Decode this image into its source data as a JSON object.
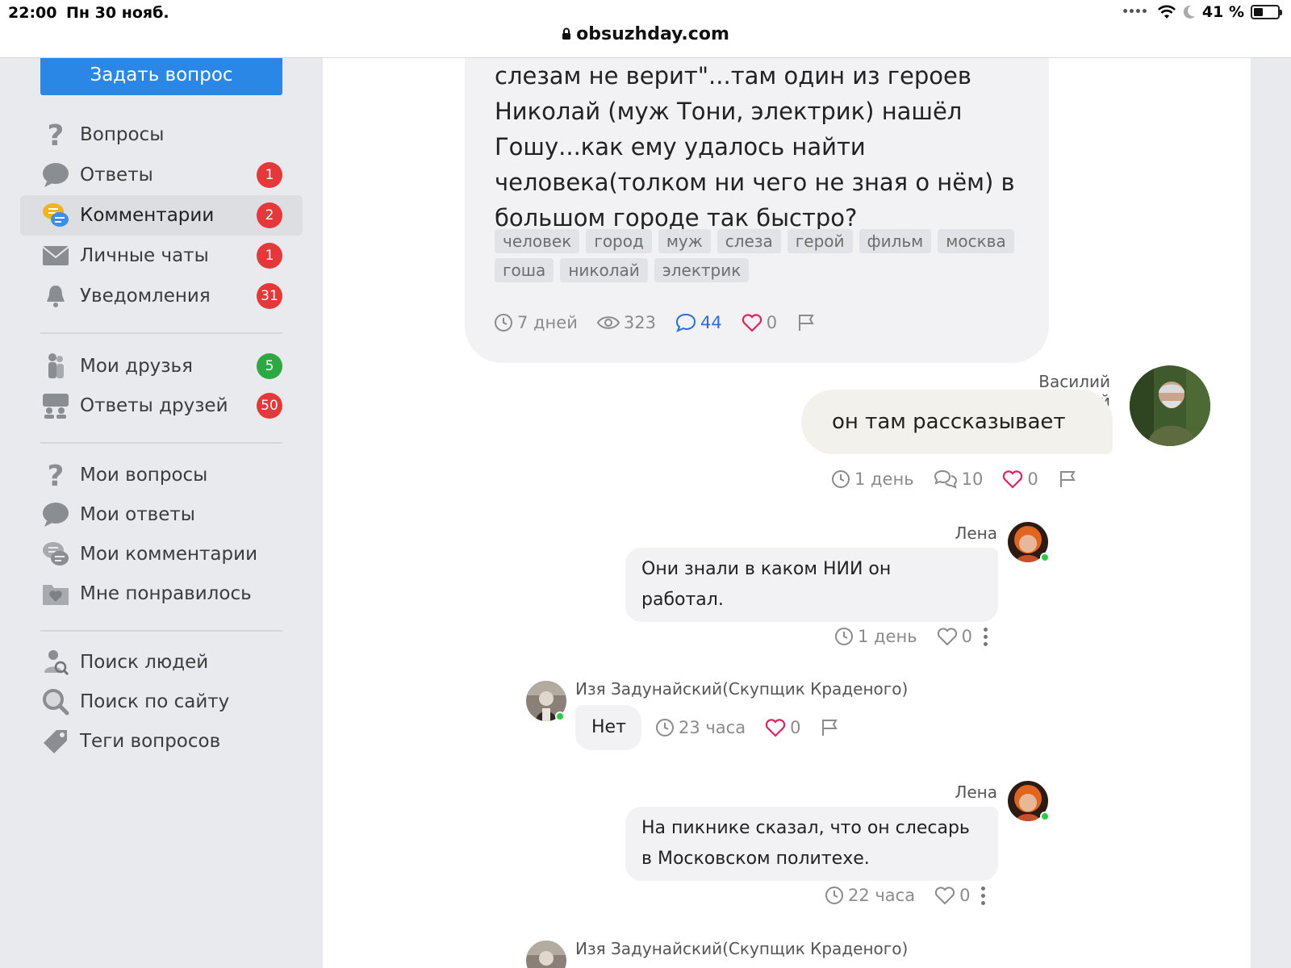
{
  "status_bar": {
    "time": "22:00",
    "date": "Пн 30 нояб.",
    "battery": "41 %",
    "battery_level": 0.41
  },
  "browser": {
    "url": "obsuzhday.com"
  },
  "sidebar": {
    "ask_button": "Задать вопрос",
    "items": [
      {
        "label": "Вопросы",
        "icon": "question-icon",
        "badge": ""
      },
      {
        "label": "Ответы",
        "icon": "chat-bubble-icon",
        "badge": "1"
      },
      {
        "label": "Комментарии",
        "icon": "comments-icon",
        "badge": "2",
        "active": true
      },
      {
        "label": "Личные чаты",
        "icon": "envelope-icon",
        "badge": "1"
      },
      {
        "label": "Уведомления",
        "icon": "bell-icon",
        "badge": "31"
      },
      {
        "label": "Мои друзья",
        "icon": "friends-icon",
        "badge": "5",
        "badge_color": "#2ea843"
      },
      {
        "label": "Ответы друзей",
        "icon": "friends-answers-icon",
        "badge": "50"
      },
      {
        "label": "Мои вопросы",
        "icon": "question-icon",
        "badge": ""
      },
      {
        "label": "Мои ответы",
        "icon": "chat-bubble-icon",
        "badge": ""
      },
      {
        "label": "Мои комментарии",
        "icon": "comments-icon",
        "badge": ""
      },
      {
        "label": "Мне понравилось",
        "icon": "heart-folder-icon",
        "badge": ""
      },
      {
        "label": "Поиск людей",
        "icon": "person-search-icon",
        "badge": ""
      },
      {
        "label": "Поиск по сайту",
        "icon": "magnifier-icon",
        "badge": ""
      },
      {
        "label": "Теги вопросов",
        "icon": "tag-icon",
        "badge": ""
      }
    ]
  },
  "question": {
    "text": "слезам не верит\"...там один из героев Николай (муж Тони, электрик) нашёл Гошу...как ему удалось найти человека(толком ни чего не зная о нём) в большом городе так быстро?",
    "tags": [
      "человек",
      "город",
      "муж",
      "слеза",
      "герой",
      "фильм",
      "москва",
      "гоша",
      "николай",
      "электрик"
    ],
    "time": "7 дней",
    "views": "323",
    "answers": "44",
    "likes": "0"
  },
  "answer": {
    "author": "Василий Галемский",
    "text": "он там рассказывает",
    "time": "1 день",
    "comments": "10",
    "likes": "0"
  },
  "comments": [
    {
      "author": "Лена",
      "text_line1": "Они знали в каком НИИ он",
      "text_line2": "работал.",
      "time": "1 день",
      "likes": "0"
    },
    {
      "author": "Изя Задунайский(Скупщик Краденого)",
      "text": "Нет",
      "time": "23 часа",
      "likes": "0"
    },
    {
      "author": "Лена",
      "text_line1": "На пикнике сказал, что он слесарь",
      "text_line2": "в Московском политехе.",
      "time": "22 часа",
      "likes": "0"
    },
    {
      "author": "Изя Задунайский(Скупщик Краденого)"
    }
  ],
  "colors": {
    "accent_blue": "#2a87e6",
    "badge_red": "#e5383b",
    "badge_green": "#2ea843",
    "heart_pink": "#e0245e",
    "link_blue": "#2a6fd6"
  }
}
